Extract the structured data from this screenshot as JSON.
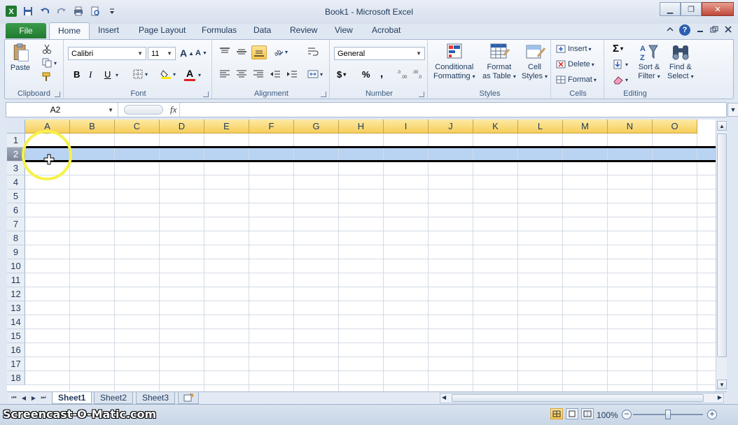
{
  "window": {
    "title": "Book1  -  Microsoft Excel",
    "minimize": "▁",
    "restore": "❐",
    "close": "✕"
  },
  "ribbon_tabs": {
    "file": "File",
    "items": [
      "Home",
      "Insert",
      "Page Layout",
      "Formulas",
      "Data",
      "Review",
      "View",
      "Acrobat"
    ],
    "help": "?"
  },
  "clipboard": {
    "paste": "Paste",
    "label": "Clipboard"
  },
  "font": {
    "name": "Calibri",
    "size": "11",
    "bold": "B",
    "italic": "I",
    "underline": "U",
    "grow": "A",
    "shrink": "A",
    "color": "A",
    "label": "Font"
  },
  "alignment": {
    "label": "Alignment"
  },
  "number": {
    "format": "General",
    "currency": "$",
    "percent": "%",
    "comma": ",",
    "label": "Number"
  },
  "styles": {
    "conditional_line1": "Conditional",
    "conditional_line2": "Formatting",
    "table_line1": "Format",
    "table_line2": "as Table",
    "cell_line1": "Cell",
    "cell_line2": "Styles",
    "label": "Styles"
  },
  "cells": {
    "insert": "Insert",
    "delete": "Delete",
    "format": "Format",
    "label": "Cells"
  },
  "editing": {
    "sigma": "Σ",
    "sort_line1": "Sort &",
    "sort_line2": "Filter",
    "find_line1": "Find &",
    "find_line2": "Select",
    "label": "Editing"
  },
  "formula_bar": {
    "name_box": "A2",
    "fx": "fx",
    "formula": ""
  },
  "grid": {
    "columns": [
      "A",
      "B",
      "C",
      "D",
      "E",
      "F",
      "G",
      "H",
      "I",
      "J",
      "K",
      "L",
      "M",
      "N",
      "O"
    ],
    "rows": [
      "1",
      "2",
      "3",
      "4",
      "5",
      "6",
      "7",
      "8",
      "9",
      "10",
      "11",
      "12",
      "13",
      "14",
      "15",
      "16",
      "17",
      "18"
    ],
    "selected_row": "2"
  },
  "sheets": {
    "tabs": [
      "Sheet1",
      "Sheet2",
      "Sheet3"
    ],
    "active": "Sheet1"
  },
  "status": {
    "zoom": "100%",
    "zoom_minus": "−",
    "zoom_plus": "+",
    "watermark": "Screencast-O-Matic.com"
  },
  "colors": {
    "accent": "#1f7a30",
    "header_selected": "#f6cd5a",
    "selection": "#b9d3f3"
  }
}
